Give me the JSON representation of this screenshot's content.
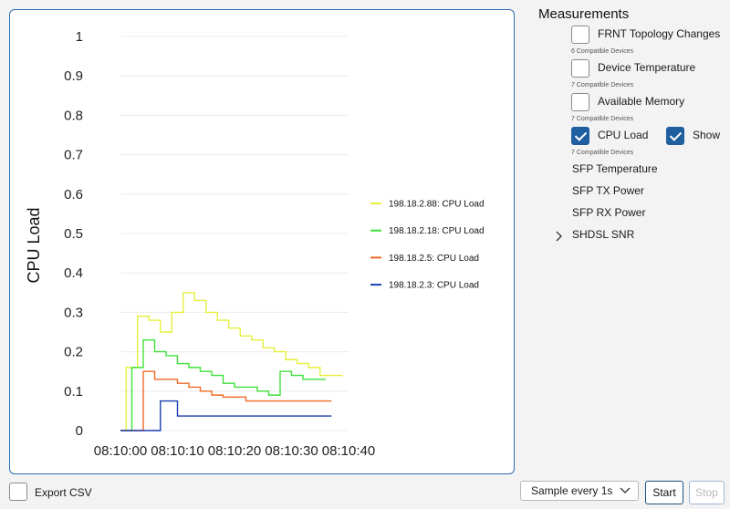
{
  "chart_data": {
    "type": "line",
    "step": true,
    "ylabel": "CPU Load",
    "xlabel": "",
    "ylim": [
      0,
      1
    ],
    "yticks": [
      "1",
      "0.9",
      "0.8",
      "0.7",
      "0.6",
      "0.5",
      "0.4",
      "0.3",
      "0.2",
      "0.1",
      "0"
    ],
    "xticks": [
      "08:10:00",
      "08:10:10",
      "08:10:20",
      "08:10:30",
      "08:10:40"
    ],
    "grid": "horizontal",
    "legend_position": "right",
    "series": [
      {
        "name": "198.18.2.88: CPU Load",
        "color": "#e6ef3c",
        "points": [
          [
            "08:10:00",
            0
          ],
          [
            "08:10:01",
            0.16
          ],
          [
            "08:10:03",
            0.29
          ],
          [
            "08:10:05",
            0.28
          ],
          [
            "08:10:07",
            0.25
          ],
          [
            "08:10:09",
            0.3
          ],
          [
            "08:10:11",
            0.35
          ],
          [
            "08:10:13",
            0.33
          ],
          [
            "08:10:15",
            0.3
          ],
          [
            "08:10:17",
            0.28
          ],
          [
            "08:10:19",
            0.26
          ],
          [
            "08:10:21",
            0.24
          ],
          [
            "08:10:23",
            0.23
          ],
          [
            "08:10:25",
            0.21
          ],
          [
            "08:10:27",
            0.2
          ],
          [
            "08:10:29",
            0.18
          ],
          [
            "08:10:31",
            0.17
          ],
          [
            "08:10:33",
            0.16
          ],
          [
            "08:10:35",
            0.14
          ],
          [
            "08:10:37",
            0.14
          ]
        ]
      },
      {
        "name": "198.18.2.18: CPU Load",
        "color": "#3ee03a",
        "points": [
          [
            "08:10:00",
            0
          ],
          [
            "08:10:02",
            0.16
          ],
          [
            "08:10:04",
            0.23
          ],
          [
            "08:10:06",
            0.2
          ],
          [
            "08:10:08",
            0.19
          ],
          [
            "08:10:10",
            0.17
          ],
          [
            "08:10:12",
            0.16
          ],
          [
            "08:10:14",
            0.15
          ],
          [
            "08:10:16",
            0.14
          ],
          [
            "08:10:18",
            0.12
          ],
          [
            "08:10:20",
            0.11
          ],
          [
            "08:10:22",
            0.11
          ],
          [
            "08:10:24",
            0.1
          ],
          [
            "08:10:26",
            0.09
          ],
          [
            "08:10:28",
            0.15
          ],
          [
            "08:10:30",
            0.14
          ],
          [
            "08:10:32",
            0.13
          ],
          [
            "08:10:34",
            0.13
          ]
        ]
      },
      {
        "name": "198.18.2.5: CPU Load",
        "color": "#f06a24",
        "points": [
          [
            "08:10:00",
            0
          ],
          [
            "08:10:04",
            0.15
          ],
          [
            "08:10:06",
            0.13
          ],
          [
            "08:10:08",
            0.13
          ],
          [
            "08:10:10",
            0.12
          ],
          [
            "08:10:12",
            0.11
          ],
          [
            "08:10:14",
            0.1
          ],
          [
            "08:10:16",
            0.09
          ],
          [
            "08:10:18",
            0.085
          ],
          [
            "08:10:22",
            0.075
          ],
          [
            "08:10:35",
            0.075
          ]
        ]
      },
      {
        "name": "198.18.2.3: CPU Load",
        "color": "#1a3fb0",
        "points": [
          [
            "08:10:00",
            0
          ],
          [
            "08:10:07",
            0.075
          ],
          [
            "08:10:10",
            0.037
          ],
          [
            "08:10:35",
            0.037
          ]
        ]
      }
    ]
  },
  "measurements": {
    "title": "Measurements",
    "items": [
      {
        "label": "FRNT Topology Changes",
        "sub": "6 Compatible Devices",
        "checked": false
      },
      {
        "label": "Device Temperature",
        "sub": "7 Compatible Devices",
        "checked": false
      },
      {
        "label": "Available Memory",
        "sub": "7 Compatible Devices",
        "checked": false
      },
      {
        "label": "CPU Load",
        "sub": "7 Compatible Devices",
        "checked": true,
        "show_label": "Show",
        "show_checked": true
      }
    ],
    "plain_items": [
      "SFP Temperature",
      "SFP TX Power",
      "SFP RX Power",
      "SHDSL SNR"
    ]
  },
  "footer": {
    "export_label": "Export CSV",
    "sample_value": "Sample every 1s",
    "start_label": "Start",
    "stop_label": "Stop"
  }
}
